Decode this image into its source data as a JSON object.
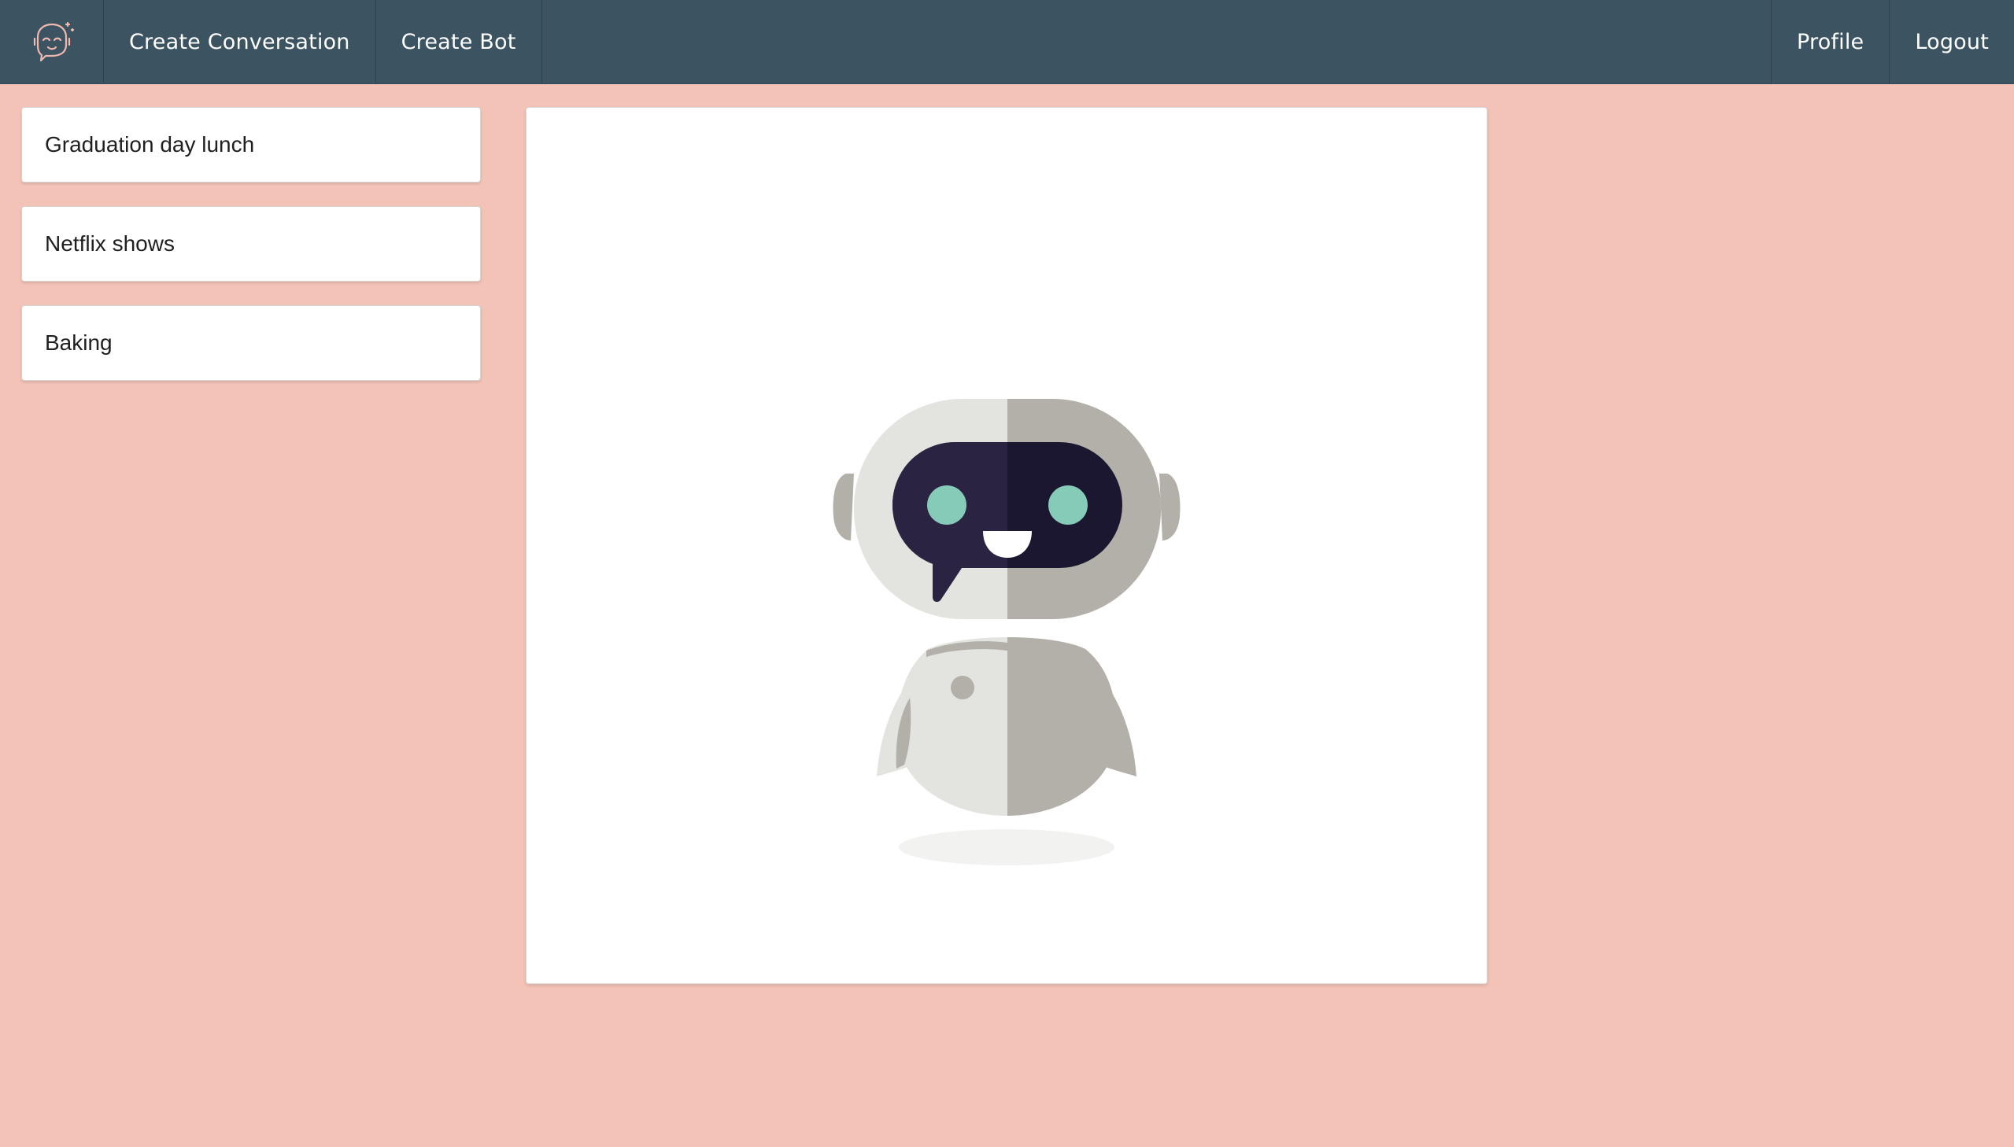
{
  "navbar": {
    "logo_icon": "robot-face-logo-icon",
    "items_left": [
      {
        "label": "Create Conversation"
      },
      {
        "label": "Create Bot"
      }
    ],
    "items_right": [
      {
        "label": "Profile"
      },
      {
        "label": "Logout"
      }
    ]
  },
  "conversations": [
    {
      "title": "Graduation day lunch"
    },
    {
      "title": "Netflix shows"
    },
    {
      "title": "Baking"
    }
  ],
  "main": {
    "illustration": "robot-illustration"
  },
  "colors": {
    "background": "#f4c3b7",
    "navbar": "#3c5461",
    "card": "#ffffff",
    "robot_eye": "#86cbb8",
    "robot_visor": "#221c34"
  }
}
